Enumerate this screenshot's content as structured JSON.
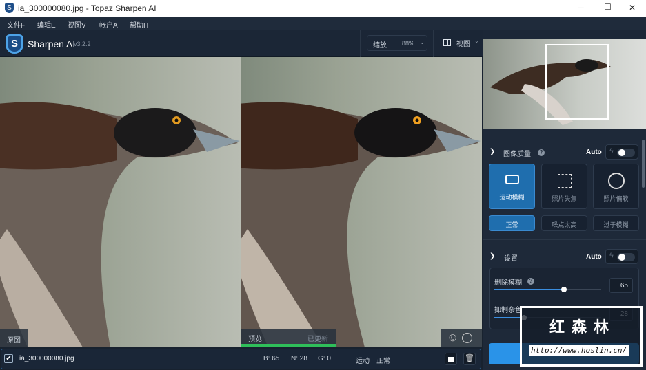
{
  "window": {
    "title": "ia_300000080.jpg - Topaz Sharpen AI",
    "minimize": "─",
    "maximize": "☐",
    "close": "✕"
  },
  "menu": [
    "文件F",
    "编辑E",
    "视图V",
    "帐户A",
    "帮助H"
  ],
  "app": {
    "name": "Sharpen AI",
    "version": "v3.2.2"
  },
  "zoom": {
    "label": "缩放",
    "value": "88%"
  },
  "view": {
    "label": "视图"
  },
  "canvas": {
    "original_label": "原图",
    "preview_label": "预览",
    "preview_status": "已更新"
  },
  "quality": {
    "title": "图像质量",
    "auto": "Auto",
    "modes": [
      "运动模糊",
      "照片失焦",
      "照片偏软"
    ],
    "submodes": [
      "正常",
      "噪点太高",
      "过于模糊"
    ]
  },
  "settings": {
    "title": "设置",
    "auto": "Auto",
    "sliders": [
      {
        "label": "删除模糊",
        "value": "65",
        "fraction": 0.65
      },
      {
        "label": "抑制杂色",
        "value": "28",
        "fraction": 0.28
      }
    ]
  },
  "filebar": {
    "filename": "ia_300000080.jpg",
    "b": "B: 65",
    "n": "N: 28",
    "g": "G: 0",
    "mode": "运动",
    "sub": "正常"
  },
  "watermark": {
    "text": "红森林",
    "url": "http://www.hoslin.cn/"
  }
}
